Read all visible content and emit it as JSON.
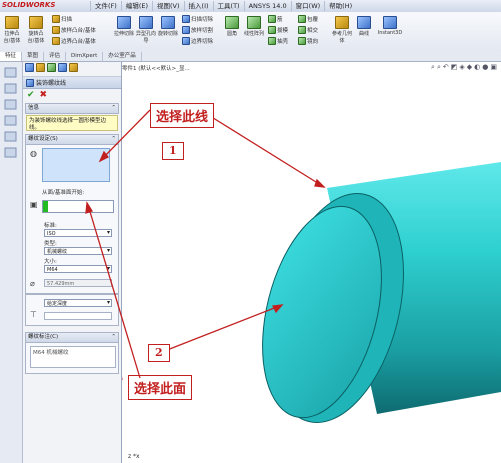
{
  "app": {
    "logo": "SOLIDWORKS"
  },
  "menu": [
    "文件(F)",
    "编辑(E)",
    "视图(V)",
    "插入(I)",
    "工具(T)",
    "ANSYS 14.0",
    "窗口(W)",
    "帮助(H)"
  ],
  "toolbar": {
    "big1": "拉伸凸台/基体",
    "big2": "旋转凸台/基体",
    "sweep": "扫描",
    "loft": "放样凸台/基体",
    "boundary": "边界凸台/基体",
    "cut_extrude": "拉伸切除",
    "hole_wizard": "异型孔向导",
    "cut_revolve": "旋转切除",
    "cut_sweep": "扫描切除",
    "cut_loft": "放样切割",
    "cut_boundary": "边界切除",
    "fillet": "圆角",
    "linear_pattern": "线性阵列",
    "rib": "筋",
    "draft": "拔模",
    "shell": "抽壳",
    "wrap": "包覆",
    "intersect": "相交",
    "mirror": "镜向",
    "ref_geom": "参考几何体",
    "curves": "曲线",
    "instant3d": "Instant3D"
  },
  "tabs": [
    "特征",
    "草图",
    "评估",
    "DimXpert",
    "办公室产品"
  ],
  "panel": {
    "title": "装饰螺纹线",
    "info_header": "信息",
    "info_text": "为装饰螺纹线选择一圆形模型边线。",
    "settings_header": "螺纹设定(S)",
    "from_label": "从面/基准面开始:",
    "standard_label": "标准:",
    "standard_value": "ISO",
    "type_label": "类型:",
    "type_value": "机械螺纹",
    "size_label": "大小:",
    "size_value": "M64",
    "diameter_value": "57.429mm",
    "depth_type": "给定深度",
    "callout_header": "螺纹标注(C)",
    "callout_text": "M64 机械螺纹"
  },
  "viewport": {
    "tree_label": "零件1 (默认<<默认>_显...",
    "callout_edge": "选择此线",
    "callout_face": "选择此面",
    "num1": "1",
    "num2": "2"
  },
  "colors": {
    "model": "#2fd0d0",
    "model_dark": "#0e6b70",
    "callout": "#c2201f"
  }
}
